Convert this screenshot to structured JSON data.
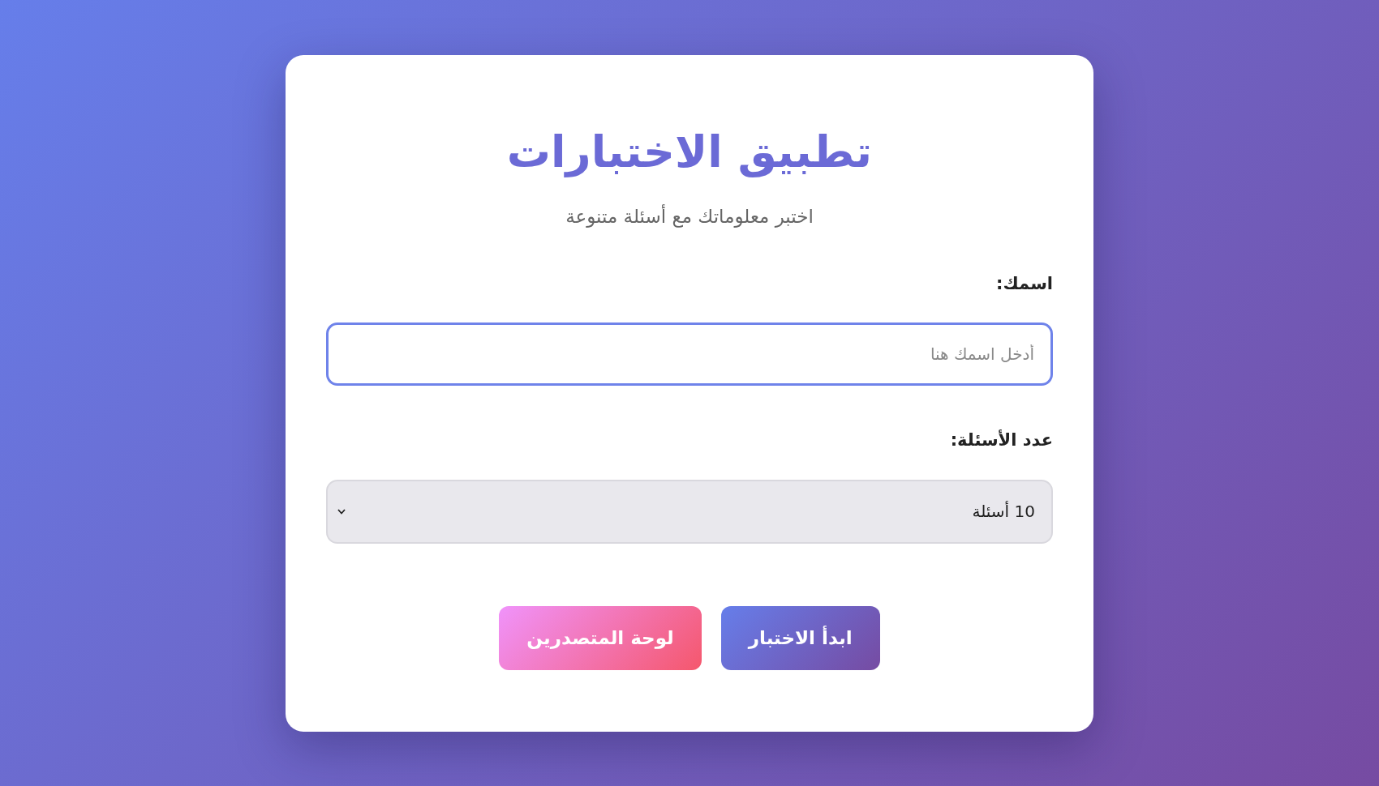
{
  "app": {
    "title": "تطبيق الاختبارات",
    "subtitle": "اختبر معلوماتك مع أسئلة متنوعة"
  },
  "form": {
    "fields": [
      {
        "kind": "text",
        "label": "اسمك:",
        "placeholder": "أدخل اسمك هنا"
      },
      {
        "kind": "select",
        "label": "عدد الأسئلة:",
        "value": "10 أسئلة"
      }
    ]
  },
  "buttons": [
    {
      "kind": "primary",
      "label": "ابدأ الاختبار"
    },
    {
      "kind": "secondary",
      "label": "لوحة المتصدرين"
    }
  ]
}
